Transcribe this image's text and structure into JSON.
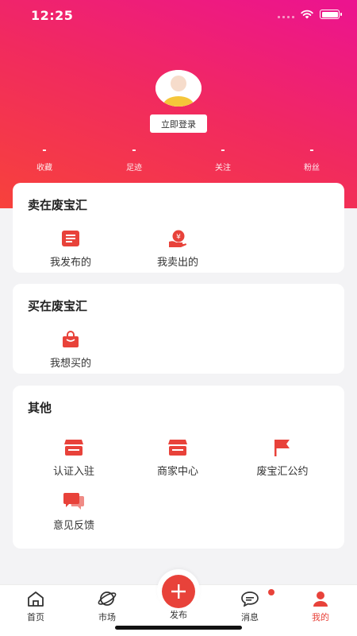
{
  "status_bar": {
    "time": "12:25"
  },
  "profile": {
    "login_button": "立即登录"
  },
  "stats": [
    {
      "value": "-",
      "label": "收藏"
    },
    {
      "value": "-",
      "label": "足迹"
    },
    {
      "value": "-",
      "label": "关注"
    },
    {
      "value": "-",
      "label": "粉丝"
    }
  ],
  "sell_section": {
    "title": "卖在废宝汇",
    "items": [
      {
        "label": "我发布的",
        "icon": "list-board-icon"
      },
      {
        "label": "我卖出的",
        "icon": "money-hand-icon"
      }
    ]
  },
  "buy_section": {
    "title": "买在废宝汇",
    "items": [
      {
        "label": "我想买的",
        "icon": "shopping-bag-icon"
      }
    ]
  },
  "other_section": {
    "title": "其他",
    "items": [
      {
        "label": "认证入驻",
        "icon": "store-icon"
      },
      {
        "label": "商家中心",
        "icon": "store-icon"
      },
      {
        "label": "废宝汇公约",
        "icon": "flag-icon"
      },
      {
        "label": "意见反馈",
        "icon": "chat-bubbles-icon"
      }
    ]
  },
  "tab_bar": {
    "tabs": [
      {
        "label": "首页",
        "icon": "home-icon"
      },
      {
        "label": "市场",
        "icon": "planet-icon"
      },
      {
        "label": "发布",
        "icon": "plus-icon"
      },
      {
        "label": "消息",
        "icon": "chat-icon"
      },
      {
        "label": "我的",
        "icon": "user-icon"
      }
    ],
    "active": "我的"
  },
  "colors": {
    "accent": "#e8423a",
    "gradient_start": "#f7423b",
    "gradient_end": "#ec1390"
  }
}
